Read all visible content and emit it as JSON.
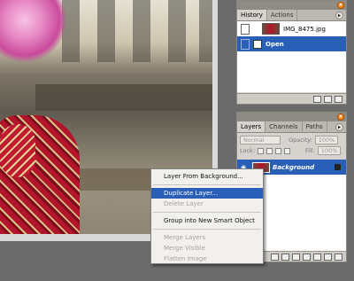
{
  "history_panel": {
    "tabs": [
      "History",
      "Actions"
    ],
    "snapshot_name": "IMG_8475.jpg",
    "steps": [
      "Open"
    ]
  },
  "layers_panel": {
    "tabs": [
      "Layers",
      "Channels",
      "Paths"
    ],
    "blend_mode": "Normal",
    "opacity_label": "Opacity:",
    "opacity_value": "100%",
    "lock_label": "Lock:",
    "fill_label": "Fill:",
    "fill_value": "100%",
    "layer_name": "Background"
  },
  "context_menu": {
    "items": [
      "Layer From Background...",
      "Duplicate Layer...",
      "Delete Layer",
      "Group into New Smart Object",
      "Merge Layers",
      "Merge Visible",
      "Flatten Image"
    ]
  },
  "colors": {
    "selection": "#2a5fb8",
    "panel_bg": "#d6d3ce",
    "close_button": "#ff8a1f"
  }
}
